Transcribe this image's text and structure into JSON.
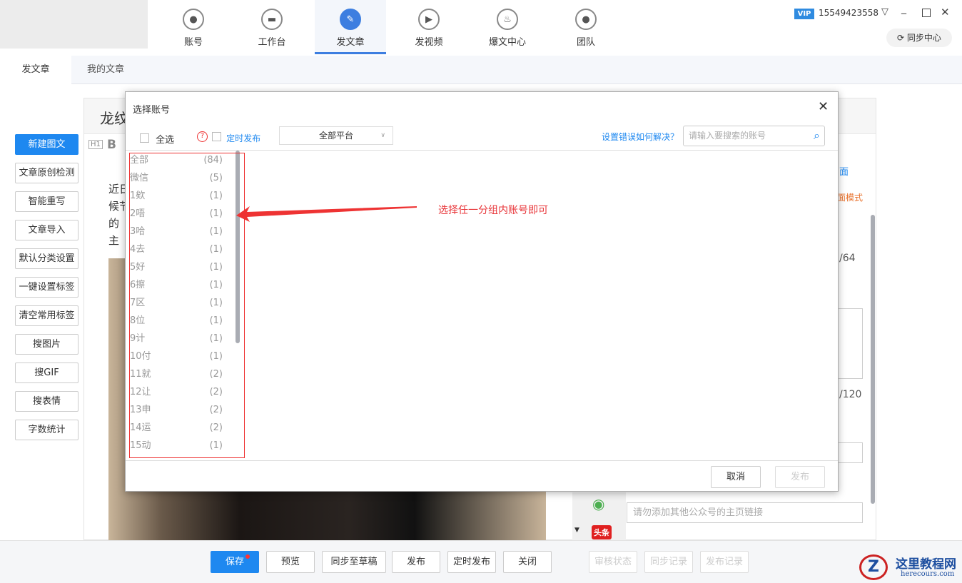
{
  "nav": [
    {
      "label": "账号",
      "icon": "user-icon",
      "glyph": "●"
    },
    {
      "label": "工作台",
      "icon": "monitor-icon",
      "glyph": "▬"
    },
    {
      "label": "发文章",
      "icon": "feather-icon",
      "glyph": "✎",
      "active": true
    },
    {
      "label": "发视频",
      "icon": "video-icon",
      "glyph": "▶"
    },
    {
      "label": "爆文中心",
      "icon": "fire-icon",
      "glyph": "♨"
    },
    {
      "label": "团队",
      "icon": "team-icon",
      "glyph": "●"
    }
  ],
  "header": {
    "vip": "VIP",
    "phone": "15549423558",
    "sync": "同步中心"
  },
  "tabs": [
    "发文章",
    "我的文章"
  ],
  "left_buttons": [
    "新建图文",
    "文章原创检测",
    "智能重写",
    "文章导入",
    "默认分类设置",
    "一键设置标签",
    "清空常用标签",
    "搜图片",
    "搜GIF",
    "搜表情",
    "字数统计"
  ],
  "editor": {
    "title": "龙纹",
    "body_lines": [
      "近日",
      "候节",
      "的",
      "主"
    ],
    "toolbar_h": "H1",
    "toolbar_b": "B"
  },
  "modal": {
    "title": "选择账号",
    "select_all": "全选",
    "timed_publish": "定时发布",
    "platform": "全部平台",
    "help_link": "设置错误如何解决？",
    "search_placeholder": "请输入要搜索的账号",
    "cancel": "取消",
    "publish": "发布",
    "groups": [
      {
        "name": "全部",
        "count": "(84)"
      },
      {
        "name": "微信",
        "count": "(5)"
      },
      {
        "name": "1欸",
        "count": "(1)"
      },
      {
        "name": "2唔",
        "count": "(1)"
      },
      {
        "name": "3哈",
        "count": "(1)"
      },
      {
        "name": "4去",
        "count": "(1)"
      },
      {
        "name": "5好",
        "count": "(1)"
      },
      {
        "name": "6擦",
        "count": "(1)"
      },
      {
        "name": "7区",
        "count": "(1)"
      },
      {
        "name": "8位",
        "count": "(1)"
      },
      {
        "name": "9计",
        "count": "(1)"
      },
      {
        "name": "10付",
        "count": "(1)"
      },
      {
        "name": "11就",
        "count": "(2)"
      },
      {
        "name": "12让",
        "count": "(2)"
      },
      {
        "name": "13申",
        "count": "(2)"
      },
      {
        "name": "14运",
        "count": "(2)"
      },
      {
        "name": "15动",
        "count": "(1)"
      }
    ]
  },
  "annotation": "选择任一分组内账号即可",
  "right_panel": {
    "link1": "面",
    "link2": "面模式",
    "count1": "/64",
    "count2": "/120",
    "homepage_placeholder": "请勿添加其他公众号的主页链接",
    "toutiao": "头条"
  },
  "footer": {
    "save": "保存",
    "preview": "预览",
    "sync_draft": "同步至草稿",
    "publish": "发布",
    "timed_publish": "定时发布",
    "close": "关闭",
    "review_status": "审核状态",
    "sync_record": "同步记录",
    "publish_record": "发布记录"
  },
  "watermark": {
    "name": "这里教程网",
    "url": "herecours.com"
  },
  "colors": {
    "accent": "#1e88f0",
    "annotation": "#e8363a"
  }
}
